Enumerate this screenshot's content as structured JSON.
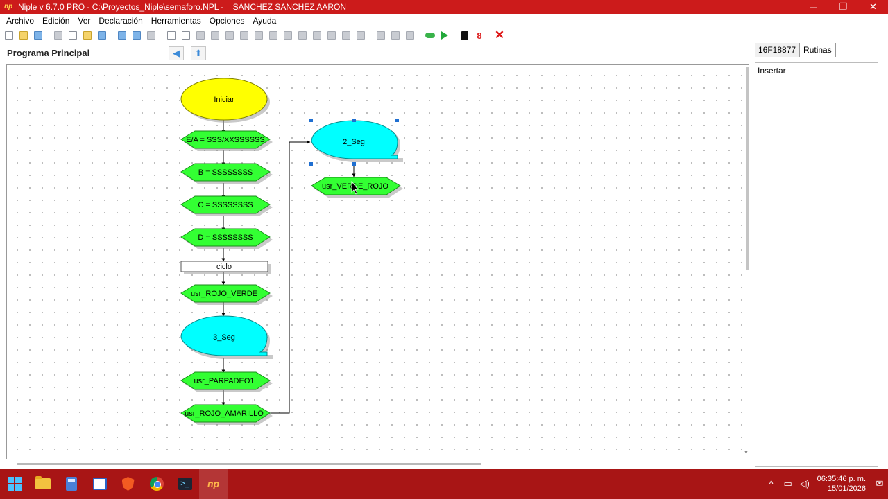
{
  "window": {
    "title": "Niple v 6.7.0 PRO - C:\\Proyectos_Niple\\semaforo.NPL -    SANCHEZ SANCHEZ AARON",
    "controls": {
      "minimize": "─",
      "restore": "❐",
      "close": "✕"
    }
  },
  "menu": {
    "items": [
      "Archivo",
      "Edición",
      "Ver",
      "Declaración",
      "Herramientas",
      "Opciones",
      "Ayuda"
    ]
  },
  "toolbar": {
    "chip_glyph": "",
    "red_glyph": "8",
    "stop_glyph": "✕"
  },
  "program": {
    "title": "Programa Principal",
    "back_glyph": "◀",
    "home_glyph": "⬆"
  },
  "flowchart": {
    "start": "Iniciar",
    "nodes": [
      "E/A = SSS/XXSSSSSS",
      "B = SSSSSSSS",
      "C = SSSSSSSS",
      "D = SSSSSSSS"
    ],
    "loop_label": "ciclo",
    "routine_rojo_verde": "usr_ROJO_VERDE",
    "delay_main": "3_Seg",
    "routine_parpadeo": "usr_PARPADEO1",
    "routine_rojo_amarillo": "usr_ROJO_AMARILLO",
    "delay_side": "2_Seg",
    "routine_verde_rojo": "usr_VERDE_ROJO"
  },
  "right_panel": {
    "tabs": [
      "16F18877",
      "Rutinas"
    ],
    "insert_label": "Insertar"
  },
  "taskbar": {
    "terminal_glyph": ">_",
    "niple_glyph": "np",
    "tray_up": "^",
    "tray_network": "▭",
    "tray_volume": "◁)",
    "time": "06:35:46 p. m.",
    "date": "15/01/2026",
    "notifications": "✉"
  },
  "colors": {
    "titlebar": "#cc1b1b",
    "taskbar": "#a81515",
    "start_node": "#ffff00",
    "io_node": "#33ff33",
    "delay_node": "#00ffff",
    "selection": "#1f6fd1"
  }
}
